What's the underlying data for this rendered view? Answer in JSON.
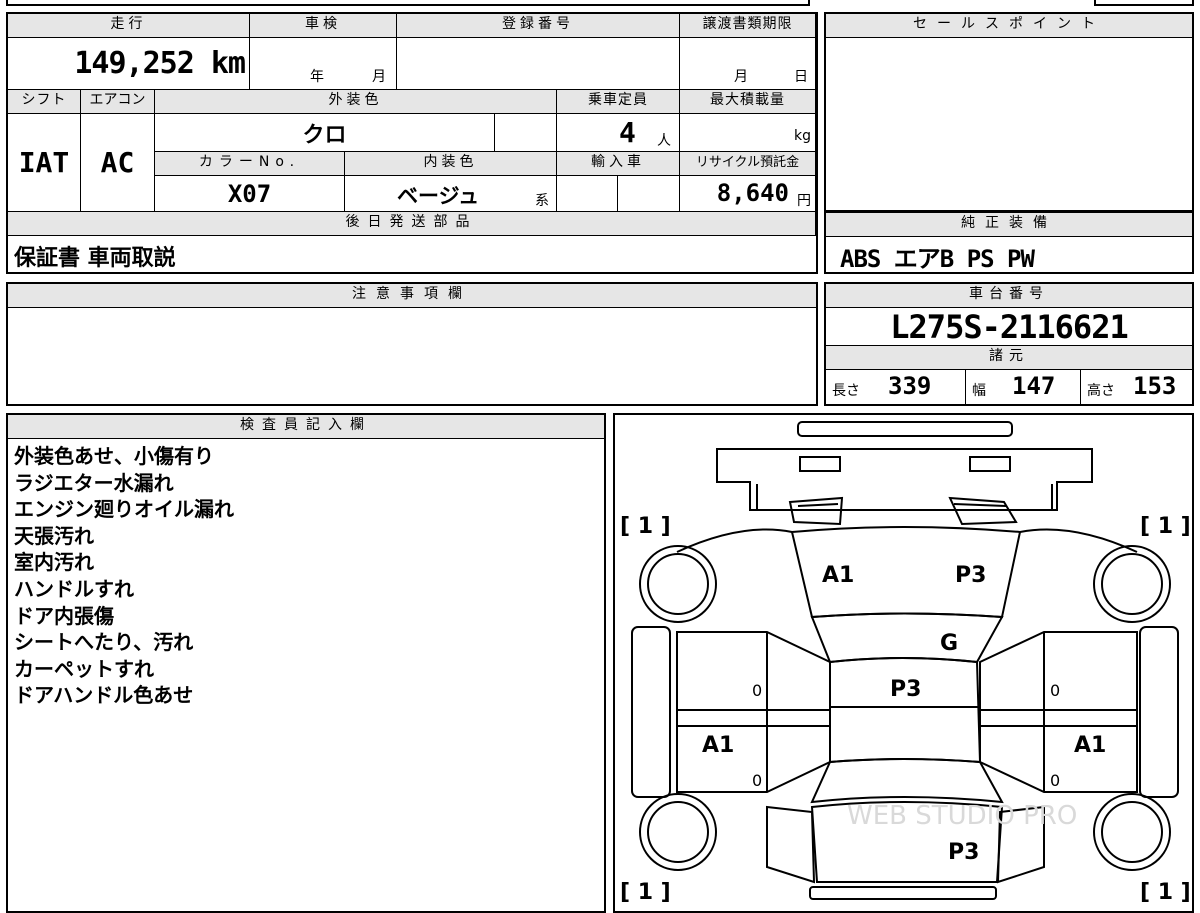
{
  "main": {
    "mileage_label": "走行",
    "mileage_value": "149,252",
    "mileage_unit": "km",
    "shaken_label": "車検",
    "shaken_year": "年",
    "shaken_month": "月",
    "reg_label": "登録番号",
    "transfer_label": "譲渡書類期限",
    "transfer_month": "月",
    "transfer_day": "日",
    "shift_label": "シフト",
    "shift_value": "IAT",
    "ac_label": "エアコン",
    "ac_value": "AC",
    "ext_color_label": "外装色",
    "ext_color_value": "クロ",
    "capacity_label": "乗車定員",
    "capacity_value": "4",
    "capacity_unit": "人",
    "maxload_label": "最大積載量",
    "maxload_unit": "kg",
    "color_no_label": "カラーNo.",
    "color_no_value": "X07",
    "int_color_label": "内装色",
    "int_color_value": "ベージュ",
    "int_color_suffix": "系",
    "import_label": "輸入車",
    "recycle_label": "リサイクル預託金",
    "recycle_value": "8,640",
    "recycle_unit": "円",
    "later_parts_label": "後日発送部品",
    "later_parts_value": "保証書 車両取説"
  },
  "side": {
    "sales_point_label": "セールスポイント",
    "equipment_label": "純正装備",
    "equipment_value": "ABS エアB PS PW",
    "chassis_label": "車台番号",
    "chassis_value": "L275S-2116621",
    "spec_label": "諸元",
    "length_label": "長さ",
    "length_value": "339",
    "width_label": "幅",
    "width_value": "147",
    "height_label": "高さ",
    "height_value": "153"
  },
  "notes": {
    "caution_label": "注意事項欄",
    "inspector_label": "検査員記入欄",
    "inspector_items": [
      "外装色あせ、小傷有り",
      "ラジエター水漏れ",
      "エンジン廻りオイル漏れ",
      "天張汚れ",
      "室内汚れ",
      "ハンドルすれ",
      "ドア内張傷",
      "シートへたり、汚れ",
      "カーペットすれ",
      "ドアハンドル色あせ"
    ]
  },
  "diagram": {
    "tire_fl": "[ 1 ]",
    "tire_fr": "[ 1 ]",
    "tire_rl": "[ 1 ]",
    "tire_rr": "[ 1 ]",
    "hood_left": "A1",
    "hood_right": "P3",
    "windshield": "G",
    "roof": "P3",
    "left_side": "A1",
    "right_side": "A1",
    "rear": "P3",
    "door_marks": [
      "0",
      "0",
      "0",
      "0"
    ],
    "watermark": "WEB STUDIO PRO"
  }
}
